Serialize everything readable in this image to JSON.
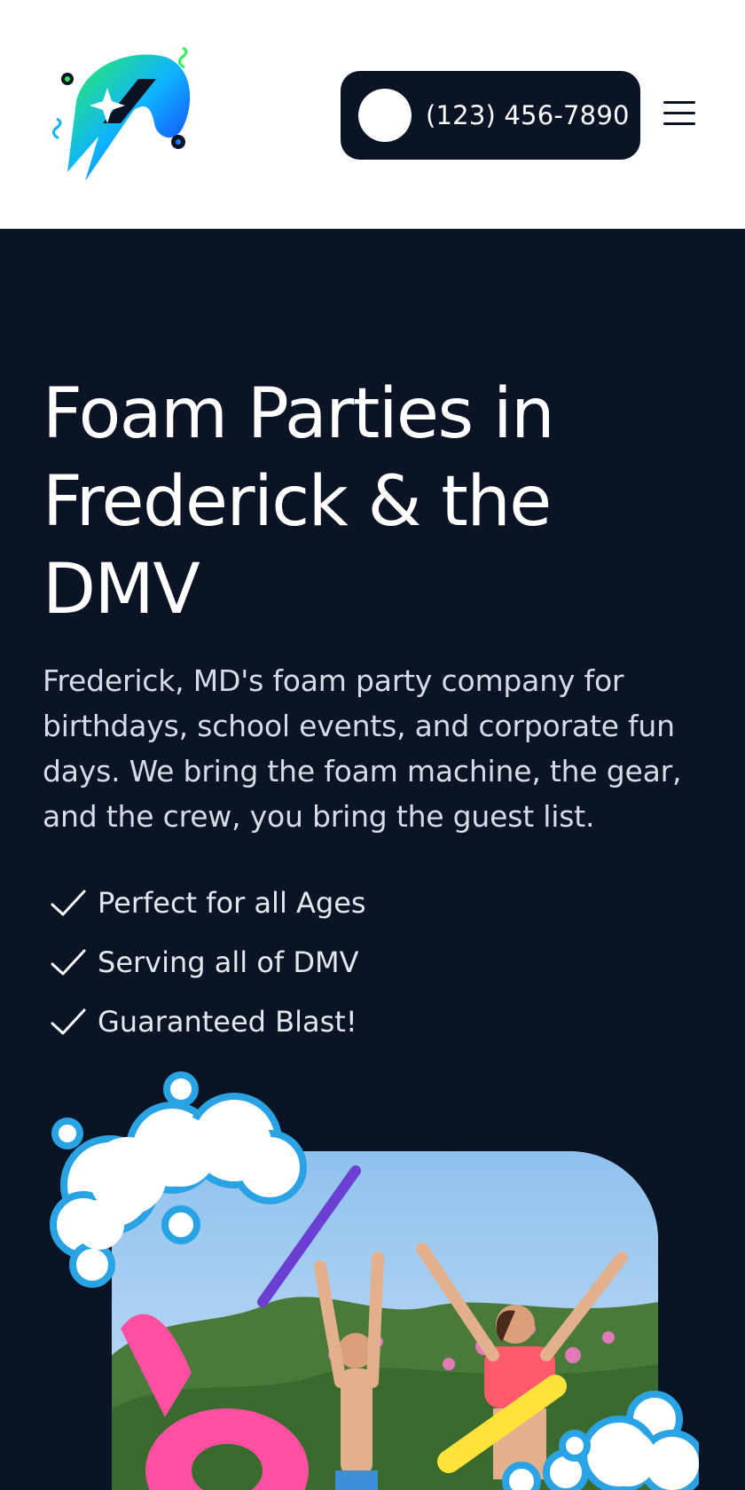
{
  "header": {
    "logo_icon": "brand-rocket-splash-icon",
    "phone": "(123) 456-7890",
    "menu_icon": "hamburger-menu-icon"
  },
  "hero": {
    "title_lines": [
      "Foam Parties in",
      "Frederick & the",
      "DMV"
    ],
    "subtitle": "Frederick, MD's foam party company for birthdays, school events, and corporate fun days. We bring the foam machine, the gear, and the crew, you bring the guest list.",
    "features": [
      "Perfect for all Ages",
      "Serving all of DMV",
      "Guaranteed Blast!"
    ],
    "feature_icon": "checkmark-icon",
    "photo_description_icon": "foam-party-photo"
  },
  "colors": {
    "navy": "#0b1425",
    "white": "#ffffff",
    "foam_blue": "#29a3e3",
    "sky": "#a9cdee"
  }
}
